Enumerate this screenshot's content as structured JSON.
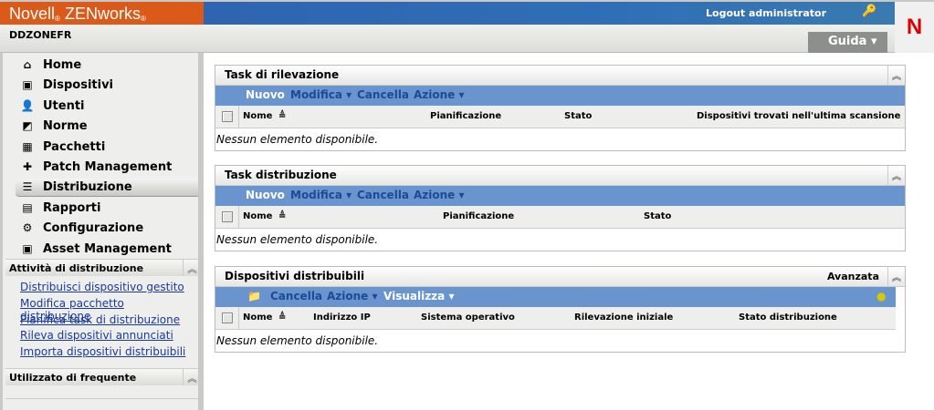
{
  "header": {
    "brand": "Novell",
    "brand_product": "ZENworks",
    "reg": "®",
    "logout": "Logout administrator",
    "zone": "DDZONEFR",
    "help": "Guida ▾",
    "logo": "N"
  },
  "sidebar": {
    "items": [
      {
        "label": "Home",
        "icon": "home-icon",
        "glyph": "⌂"
      },
      {
        "label": "Dispositivi",
        "icon": "monitor-icon",
        "glyph": "▣"
      },
      {
        "label": "Utenti",
        "icon": "user-icon",
        "glyph": "👤"
      },
      {
        "label": "Norme",
        "icon": "policy-icon",
        "glyph": "◩"
      },
      {
        "label": "Pacchetti",
        "icon": "package-icon",
        "glyph": "▦"
      },
      {
        "label": "Patch Management",
        "icon": "patch-icon",
        "glyph": "✚"
      },
      {
        "label": "Distribuzione",
        "icon": "deployment-icon",
        "glyph": "☰"
      },
      {
        "label": "Rapporti",
        "icon": "report-icon",
        "glyph": "▤"
      },
      {
        "label": "Configurazione",
        "icon": "config-gear-icon",
        "glyph": "⚙"
      },
      {
        "label": "Asset Management",
        "icon": "asset-icon",
        "glyph": "▣"
      }
    ],
    "section1": {
      "title": "Attività di distribuzione",
      "links": [
        "Distribuisci dispositivo gestito",
        "Modifica pacchetto distribuzione",
        "Pianifica task di distribuzione",
        "Rileva dispositivi annunciati",
        "Importa dispositivi distribuibili"
      ]
    },
    "section2": {
      "title": "Utilizzato di frequente"
    }
  },
  "panels": {
    "p1": {
      "title": "Task di rilevazione",
      "toolbar": [
        "Nuovo",
        "Modifica ▾",
        "Cancella",
        "Azione ▾"
      ],
      "columns": [
        "Nome",
        "Pianificazione",
        "Stato",
        "Dispositivi trovati nell'ultima scansione"
      ],
      "empty": "Nessun elemento disponibile."
    },
    "p2": {
      "title": "Task distribuzione",
      "toolbar": [
        "Nuovo",
        "Modifica ▾",
        "Cancella",
        "Azione ▾"
      ],
      "columns": [
        "Nome",
        "Pianificazione",
        "Stato"
      ],
      "empty": "Nessun elemento disponibile."
    },
    "p3": {
      "title": "Dispositivi distribuibili",
      "advanced": "Avanzata",
      "toolbar": [
        "Cancella",
        "Azione ▾",
        "Visualizza ▾"
      ],
      "columns": [
        "Nome",
        "Indirizzo IP",
        "Sistema operativo",
        "Rilevazione iniziale",
        "Stato distribuzione"
      ],
      "empty": "Nessun elemento disponibile."
    }
  },
  "sort_glyph": "≜"
}
